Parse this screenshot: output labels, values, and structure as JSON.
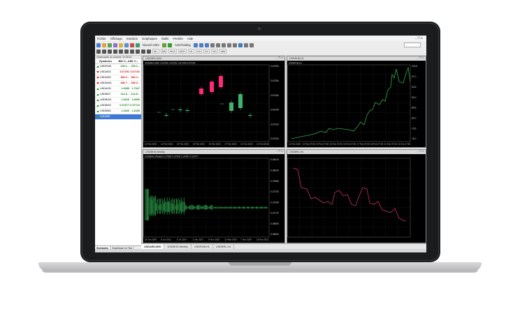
{
  "menu": [
    "Fichier",
    "Affichage",
    "Insertion",
    "Graphiques",
    "Outils",
    "Fenêtre",
    "Aide"
  ],
  "toolbar": {
    "new_order_label": "Nouvel ordre",
    "autotrading_label": "AutoTrading",
    "timeframes": [
      "M1",
      "M5",
      "M15",
      "M30",
      "H1",
      "H4",
      "D1",
      "W1",
      "MN"
    ]
  },
  "market_watch": {
    "title": "Observation du marché: 20:35:33",
    "columns": [
      "Symboles",
      "BID C...",
      "ASK C..."
    ],
    "rows": [
      {
        "symbol": "USDRUB",
        "bid": "105.1...",
        "ask": "105.1...",
        "dir": "up"
      },
      {
        "symbol": "USDAED",
        "bid": "3.67251",
        "ask": "3.67192",
        "dir": "down"
      },
      {
        "symbol": "USDARS",
        "bid": "380.2...",
        "ask": "380.2...",
        "dir": "down"
      },
      {
        "symbol": "USDAMD",
        "bid": "389.7...",
        "ask": "395.0...",
        "dir": "down"
      },
      {
        "symbol": "USDAZN",
        "bid": "1.6955",
        "ask": "1.7047",
        "dir": "up"
      },
      {
        "symbol": "USDBDT",
        "bid": "114.6...",
        "ask": "114.5...",
        "dir": "up"
      },
      {
        "symbol": "USDBGN",
        "bid": "1.8425",
        "ask": "1.8506",
        "dir": "up"
      },
      {
        "symbol": "USDBHD",
        "bid": "0.37677",
        "ask": "0.37713",
        "dir": "up"
      },
      {
        "symbol": "USDBND",
        "bid": "1.3426",
        "ask": "1.3435",
        "dir": "up"
      },
      {
        "symbol": "USDBRL",
        "bid": "",
        "ask": "",
        "dir": "up",
        "selected": true
      }
    ],
    "tabs": [
      "Symboles",
      "Graphique en Tick"
    ]
  },
  "charts": [
    {
      "title": "USDAED,M30",
      "info": "USDAED,M30  3.67250 3.67251 3.67245 3.67245",
      "x_labels": [
        "11 Feb 2023",
        "13 Feb 2023",
        "14 Feb 2023",
        "15 Feb 2023",
        "16 Feb 2023",
        "17 Feb 2023",
        "21 Feb 2023",
        "21 Feb 08:00"
      ],
      "y_labels": [
        "3.67300",
        "3.67280",
        "3.67260",
        "3.67240",
        "3.67220",
        "3.67200"
      ]
    },
    {
      "title": "USDRUB,H1",
      "info": "USDRUB,H1",
      "x_labels": [
        "11 Feb 2023",
        "13 Feb 07:00",
        "14 Feb 07:00",
        "15 Feb 07:00",
        "16 Feb 07:00",
        "17 Feb 07:00",
        "18 Feb 07:00",
        "21 Feb 07:00",
        "21 Feb 17:00"
      ],
      "y_labels": [
        "100.5",
        "97.0",
        "93.5",
        "90.0",
        "86.5",
        "83.0",
        "79.5",
        "76.0"
      ]
    },
    {
      "title": "USDBHD,Weekly",
      "info": "USDBHD,Weekly  0.37582 0.37602 0.37457 0.37477",
      "x_labels": [
        "26 Jan 2009",
        "8 Jun 2011",
        "5 Jul 2014",
        "3 Jan 2017",
        "8 Nov 2019",
        "11 May 2020",
        "7 Dec 2020",
        "26 Sep 2021"
      ],
      "y_labels": [
        "0.38475",
        "0.38240",
        "0.37965",
        "0.37700",
        "0.37435",
        "0.37170",
        "0.36905",
        "0.36640"
      ]
    },
    {
      "title": "USDBRL,H4",
      "info": "",
      "x_labels": [],
      "y_labels": []
    }
  ],
  "bottom_tabs": [
    "USDAED,M30",
    "USDBHD,Weekly",
    "USDRUB,H1",
    "USDBRL,H4"
  ]
}
